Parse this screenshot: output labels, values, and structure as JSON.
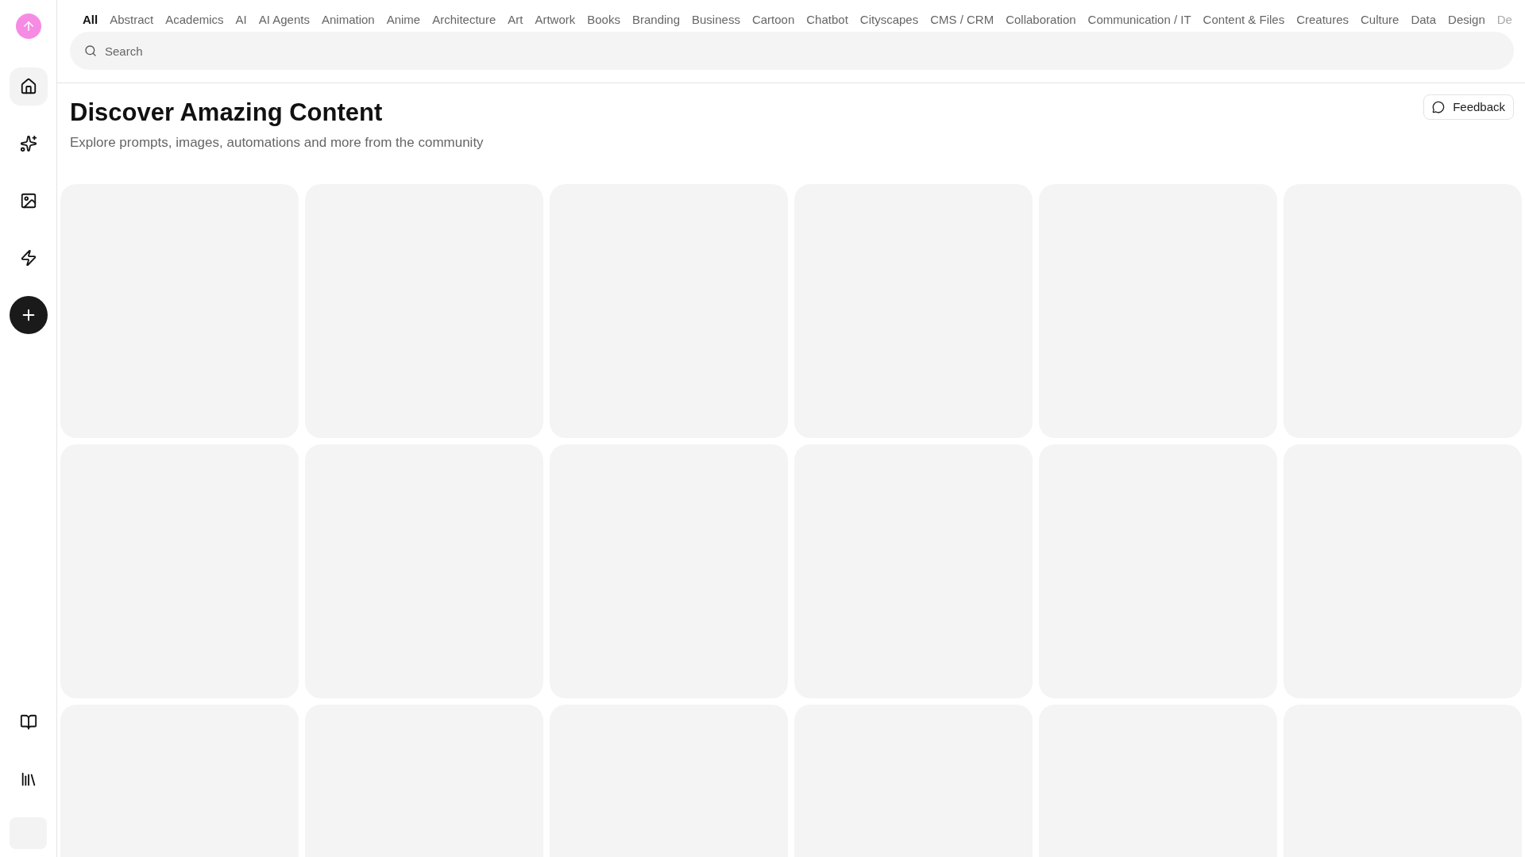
{
  "sidebar": {
    "nav_items": [
      {
        "kind": "home",
        "selected": true
      },
      {
        "kind": "sparkles",
        "selected": false
      },
      {
        "kind": "image",
        "selected": false
      },
      {
        "kind": "zap",
        "selected": false
      }
    ],
    "bottom_items": [
      {
        "kind": "book"
      },
      {
        "kind": "library"
      }
    ]
  },
  "categories": [
    {
      "label": "All",
      "selected": true
    },
    {
      "label": "Abstract",
      "selected": false
    },
    {
      "label": "Academics",
      "selected": false
    },
    {
      "label": "AI",
      "selected": false
    },
    {
      "label": "AI Agents",
      "selected": false
    },
    {
      "label": "Animation",
      "selected": false
    },
    {
      "label": "Anime",
      "selected": false
    },
    {
      "label": "Architecture",
      "selected": false
    },
    {
      "label": "Art",
      "selected": false
    },
    {
      "label": "Artwork",
      "selected": false
    },
    {
      "label": "Books",
      "selected": false
    },
    {
      "label": "Branding",
      "selected": false
    },
    {
      "label": "Business",
      "selected": false
    },
    {
      "label": "Cartoon",
      "selected": false
    },
    {
      "label": "Chatbot",
      "selected": false
    },
    {
      "label": "Cityscapes",
      "selected": false
    },
    {
      "label": "CMS / CRM",
      "selected": false
    },
    {
      "label": "Collaboration",
      "selected": false
    },
    {
      "label": "Communication / IT",
      "selected": false
    },
    {
      "label": "Content & Files",
      "selected": false
    },
    {
      "label": "Creatures",
      "selected": false
    },
    {
      "label": "Culture",
      "selected": false
    },
    {
      "label": "Data",
      "selected": false
    },
    {
      "label": "Design",
      "selected": false
    },
    {
      "label": "De",
      "selected": false
    }
  ],
  "search": {
    "placeholder": "Search"
  },
  "header": {
    "title": "Discover Amazing Content",
    "subtitle": "Explore prompts, images, automations and more from the community",
    "feedback_button": "Feedback"
  },
  "cards": [
    {
      "kind": "loading"
    },
    {
      "kind": "loading"
    },
    {
      "kind": "loading"
    },
    {
      "kind": "loading"
    },
    {
      "kind": "loading"
    },
    {
      "kind": "loading"
    },
    {
      "kind": "loading"
    },
    {
      "kind": "loading"
    },
    {
      "kind": "loading"
    },
    {
      "kind": "loading"
    },
    {
      "kind": "loading"
    },
    {
      "kind": "loading"
    },
    {
      "kind": "loading"
    },
    {
      "kind": "loading"
    },
    {
      "kind": "loading"
    },
    {
      "kind": "loading"
    },
    {
      "kind": "loading"
    },
    {
      "kind": "loading"
    }
  ]
}
